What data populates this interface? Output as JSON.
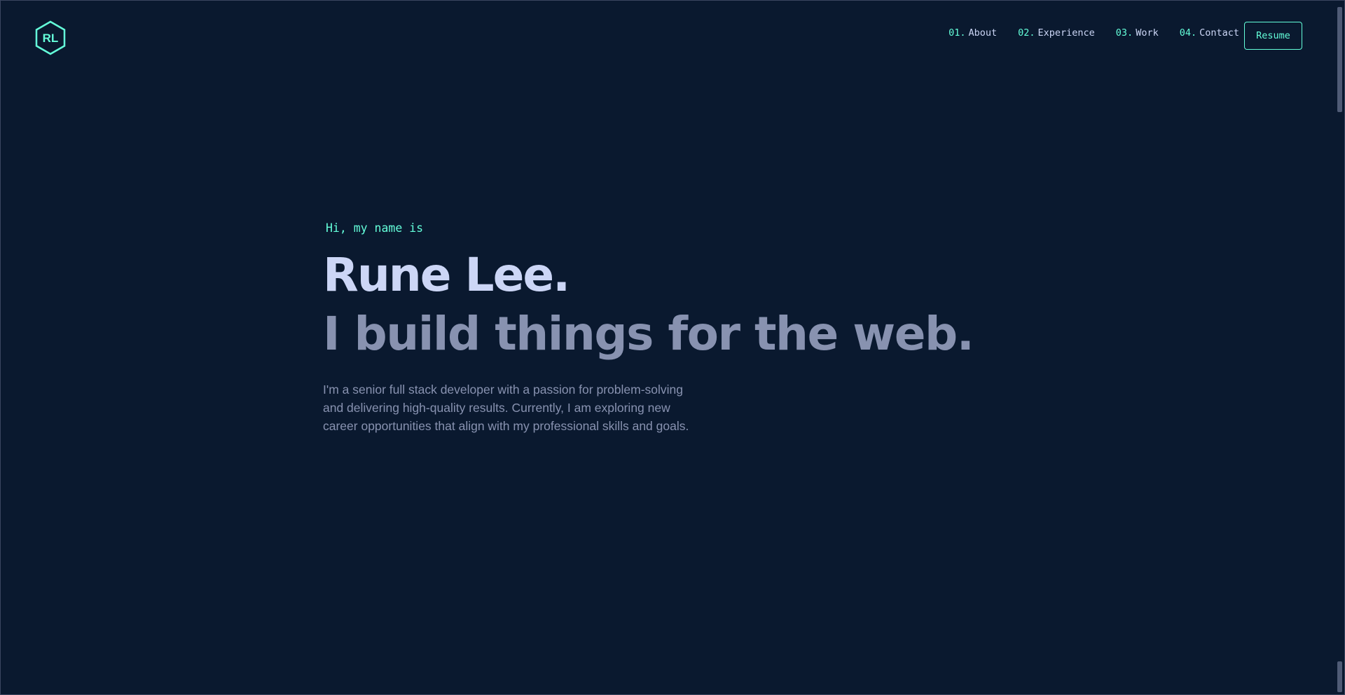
{
  "brand": {
    "logo_text": "RL",
    "accent_color": "#64ffda",
    "background_color": "#0a192f",
    "heading_color": "#ccd6f6",
    "muted_color": "#8892b0"
  },
  "nav": {
    "items": [
      {
        "number": "01.",
        "label": "About"
      },
      {
        "number": "02.",
        "label": "Experience"
      },
      {
        "number": "03.",
        "label": "Work"
      },
      {
        "number": "04.",
        "label": "Contact"
      }
    ],
    "resume_label": "Resume"
  },
  "hero": {
    "greeting": "Hi, my name is",
    "name": "Rune Lee.",
    "tagline": "I build things for the web.",
    "intro": "I'm a senior full stack developer with a passion for problem-solving and delivering high-quality results. Currently, I am exploring new career opportunities that align with my professional skills and goals."
  }
}
